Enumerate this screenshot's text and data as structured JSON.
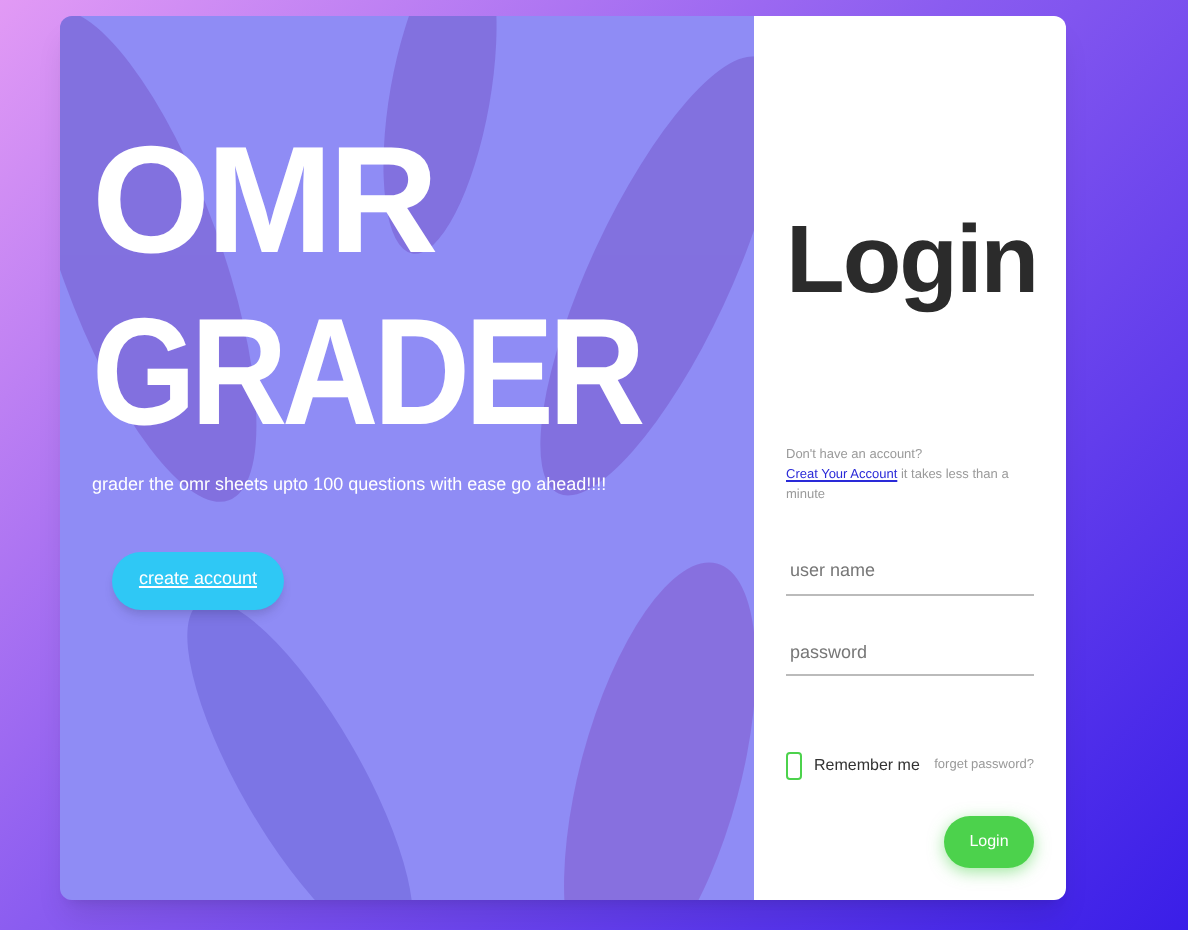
{
  "hero": {
    "title_line_1": "OMR",
    "title_line_2": "GRADER",
    "tagline": "grader the omr sheets upto 100 questions with ease go ahead!!!!",
    "create_button": "create account"
  },
  "login": {
    "title": "Login",
    "prompt": "Don't have an account?",
    "signup_link": "Creat Your Account",
    "prompt_rest": "it takes less than a minute",
    "username": {
      "placeholder": "user name"
    },
    "password": {
      "placeholder": "password"
    },
    "remember": {
      "label": "Remember me",
      "checked": false
    },
    "forgot": "forget password?",
    "submit": "Login"
  }
}
